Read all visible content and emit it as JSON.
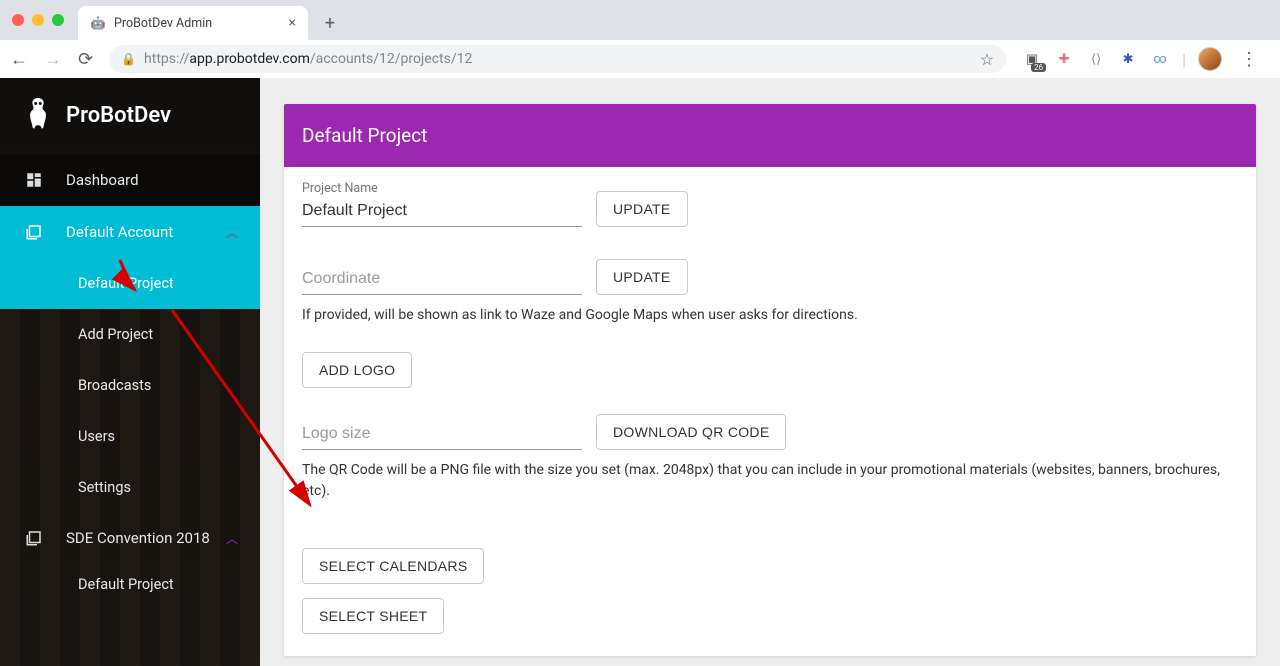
{
  "browser": {
    "tab_title": "ProBotDev Admin",
    "url_prefix": "https://",
    "url_host": "app.probotdev.com",
    "url_path": "/accounts/12/projects/12",
    "ext_badge": "26"
  },
  "brand": {
    "name": "ProBotDev"
  },
  "nav": {
    "dashboard": "Dashboard",
    "account": "Default Account",
    "sub_default_project": "Default Project",
    "sub_add_project": "Add Project",
    "sub_broadcasts": "Broadcasts",
    "sub_users": "Users",
    "sub_settings": "Settings",
    "sde": "SDE Convention 2018",
    "sde_default_project": "Default Project"
  },
  "page": {
    "header": "Default Project",
    "project_name_label": "Project Name",
    "project_name_value": "Default Project",
    "update_label": "UPDATE",
    "coord_placeholder": "Coordinate",
    "coord_help": "If provided, will be shown as link to Waze and Google Maps when user asks for directions.",
    "add_logo_label": "ADD LOGO",
    "logo_size_placeholder": "Logo size",
    "download_qr_label": "DOWNLOAD QR CODE",
    "qr_help": "The QR Code will be a PNG file with the size you set (max. 2048px) that you can include in your promotional materials (websites, banners, brochures, etc).",
    "select_calendars_label": "SELECT CALENDARS",
    "select_sheet_label": "SELECT SHEET"
  }
}
